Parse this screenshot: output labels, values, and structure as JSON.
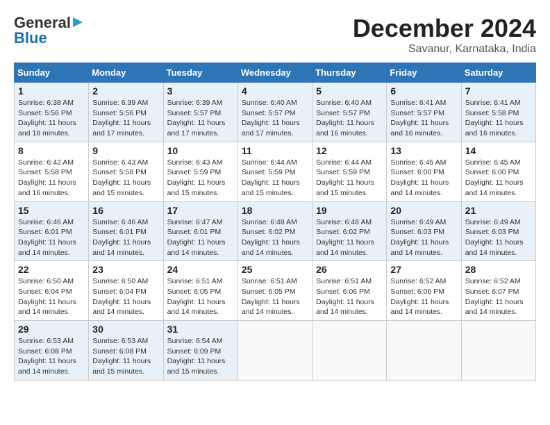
{
  "logo": {
    "line1": "General",
    "line2": "Blue",
    "arrow": "▶"
  },
  "title": "December 2024",
  "location": "Savanur, Karnataka, India",
  "days_of_week": [
    "Sunday",
    "Monday",
    "Tuesday",
    "Wednesday",
    "Thursday",
    "Friday",
    "Saturday"
  ],
  "weeks": [
    [
      {
        "day": 1,
        "sunrise": "6:38 AM",
        "sunset": "5:56 PM",
        "daylight": "11 hours and 18 minutes."
      },
      {
        "day": 2,
        "sunrise": "6:39 AM",
        "sunset": "5:56 PM",
        "daylight": "11 hours and 17 minutes."
      },
      {
        "day": 3,
        "sunrise": "6:39 AM",
        "sunset": "5:57 PM",
        "daylight": "11 hours and 17 minutes."
      },
      {
        "day": 4,
        "sunrise": "6:40 AM",
        "sunset": "5:57 PM",
        "daylight": "11 hours and 17 minutes."
      },
      {
        "day": 5,
        "sunrise": "6:40 AM",
        "sunset": "5:57 PM",
        "daylight": "11 hours and 16 minutes."
      },
      {
        "day": 6,
        "sunrise": "6:41 AM",
        "sunset": "5:57 PM",
        "daylight": "11 hours and 16 minutes."
      },
      {
        "day": 7,
        "sunrise": "6:41 AM",
        "sunset": "5:58 PM",
        "daylight": "11 hours and 16 minutes."
      }
    ],
    [
      {
        "day": 8,
        "sunrise": "6:42 AM",
        "sunset": "5:58 PM",
        "daylight": "11 hours and 16 minutes."
      },
      {
        "day": 9,
        "sunrise": "6:43 AM",
        "sunset": "5:58 PM",
        "daylight": "11 hours and 15 minutes."
      },
      {
        "day": 10,
        "sunrise": "6:43 AM",
        "sunset": "5:59 PM",
        "daylight": "11 hours and 15 minutes."
      },
      {
        "day": 11,
        "sunrise": "6:44 AM",
        "sunset": "5:59 PM",
        "daylight": "11 hours and 15 minutes."
      },
      {
        "day": 12,
        "sunrise": "6:44 AM",
        "sunset": "5:59 PM",
        "daylight": "11 hours and 15 minutes."
      },
      {
        "day": 13,
        "sunrise": "6:45 AM",
        "sunset": "6:00 PM",
        "daylight": "11 hours and 14 minutes."
      },
      {
        "day": 14,
        "sunrise": "6:45 AM",
        "sunset": "6:00 PM",
        "daylight": "11 hours and 14 minutes."
      }
    ],
    [
      {
        "day": 15,
        "sunrise": "6:46 AM",
        "sunset": "6:01 PM",
        "daylight": "11 hours and 14 minutes."
      },
      {
        "day": 16,
        "sunrise": "6:46 AM",
        "sunset": "6:01 PM",
        "daylight": "11 hours and 14 minutes."
      },
      {
        "day": 17,
        "sunrise": "6:47 AM",
        "sunset": "6:01 PM",
        "daylight": "11 hours and 14 minutes."
      },
      {
        "day": 18,
        "sunrise": "6:48 AM",
        "sunset": "6:02 PM",
        "daylight": "11 hours and 14 minutes."
      },
      {
        "day": 19,
        "sunrise": "6:48 AM",
        "sunset": "6:02 PM",
        "daylight": "11 hours and 14 minutes."
      },
      {
        "day": 20,
        "sunrise": "6:49 AM",
        "sunset": "6:03 PM",
        "daylight": "11 hours and 14 minutes."
      },
      {
        "day": 21,
        "sunrise": "6:49 AM",
        "sunset": "6:03 PM",
        "daylight": "11 hours and 14 minutes."
      }
    ],
    [
      {
        "day": 22,
        "sunrise": "6:50 AM",
        "sunset": "6:04 PM",
        "daylight": "11 hours and 14 minutes."
      },
      {
        "day": 23,
        "sunrise": "6:50 AM",
        "sunset": "6:04 PM",
        "daylight": "11 hours and 14 minutes."
      },
      {
        "day": 24,
        "sunrise": "6:51 AM",
        "sunset": "6:05 PM",
        "daylight": "11 hours and 14 minutes."
      },
      {
        "day": 25,
        "sunrise": "6:51 AM",
        "sunset": "6:05 PM",
        "daylight": "11 hours and 14 minutes."
      },
      {
        "day": 26,
        "sunrise": "6:51 AM",
        "sunset": "6:06 PM",
        "daylight": "11 hours and 14 minutes."
      },
      {
        "day": 27,
        "sunrise": "6:52 AM",
        "sunset": "6:06 PM",
        "daylight": "11 hours and 14 minutes."
      },
      {
        "day": 28,
        "sunrise": "6:52 AM",
        "sunset": "6:07 PM",
        "daylight": "11 hours and 14 minutes."
      }
    ],
    [
      {
        "day": 29,
        "sunrise": "6:53 AM",
        "sunset": "6:08 PM",
        "daylight": "11 hours and 14 minutes."
      },
      {
        "day": 30,
        "sunrise": "6:53 AM",
        "sunset": "6:08 PM",
        "daylight": "11 hours and 15 minutes."
      },
      {
        "day": 31,
        "sunrise": "6:54 AM",
        "sunset": "6:09 PM",
        "daylight": "11 hours and 15 minutes."
      },
      null,
      null,
      null,
      null
    ]
  ]
}
